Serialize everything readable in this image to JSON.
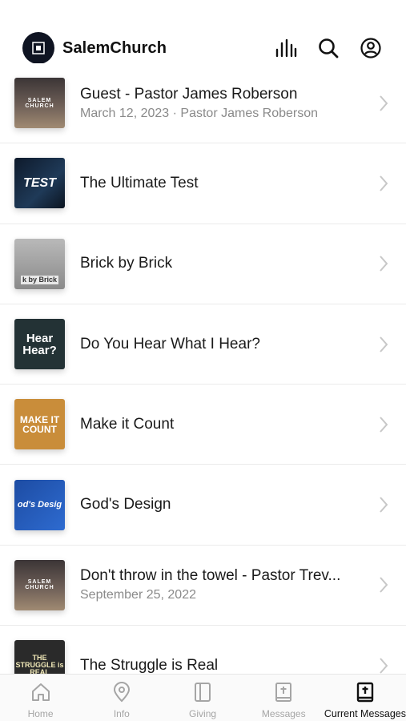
{
  "header": {
    "app_title": "SalemChurch",
    "icons": [
      "church-logo",
      "audio-bars-icon",
      "search-icon",
      "account-icon"
    ]
  },
  "messages": [
    {
      "title": "Guest - Pastor James Roberson",
      "subtitle": "March 12, 2023 · Pastor James Roberson",
      "thumb_text": "SALEM CHURCH"
    },
    {
      "title": "The Ultimate Test",
      "subtitle": "",
      "thumb_text": "TEST"
    },
    {
      "title": "Brick by Brick",
      "subtitle": "",
      "thumb_text": "k by Brick"
    },
    {
      "title": "Do You Hear What I Hear?",
      "subtitle": "",
      "thumb_text": "Hear Hear?"
    },
    {
      "title": "Make it Count",
      "subtitle": "",
      "thumb_text": "MAKE IT COUNT"
    },
    {
      "title": "God's Design",
      "subtitle": "",
      "thumb_text": "od's Desig"
    },
    {
      "title": "Don't throw in the towel - Pastor Trev...",
      "subtitle": "September 25, 2022",
      "thumb_text": "SALEM CHURCH"
    },
    {
      "title": "The Struggle is Real",
      "subtitle": "",
      "thumb_text": "THE STRUGGLE is REAL"
    }
  ],
  "tabs": [
    {
      "label": "Home",
      "icon": "home-icon"
    },
    {
      "label": "Info",
      "icon": "location-pin-icon"
    },
    {
      "label": "Giving",
      "icon": "book-panel-icon"
    },
    {
      "label": "Messages",
      "icon": "bible-icon"
    },
    {
      "label": "Current Messages",
      "icon": "bible-icon",
      "active": true
    }
  ],
  "colors": {
    "accent": "#111111",
    "inactive_tab": "#a5a5a5",
    "subtitle": "#8a8a8a",
    "logo_bg": "#0f1422"
  }
}
